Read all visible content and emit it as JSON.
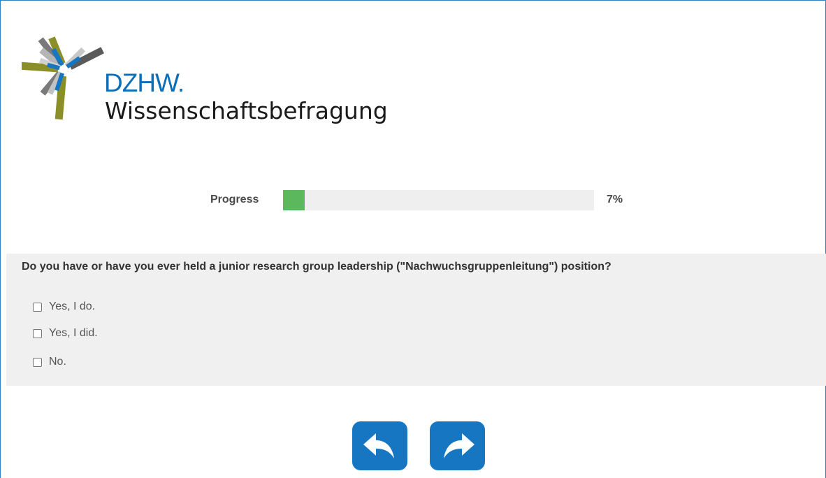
{
  "logo": {
    "abbrev": "DZHW.",
    "name": "Wissenschaftsbefragung"
  },
  "progress": {
    "label": "Progress",
    "percent": 7,
    "value_text": "7%",
    "fill_color": "#5cb85c"
  },
  "question": {
    "text": "Do you have or have you ever held a junior research group leadership (\"Nachwuchsgruppenleitung\") position?",
    "options": [
      {
        "label": "Yes, I do.",
        "checked": false
      },
      {
        "label": "Yes, I did.",
        "checked": false
      },
      {
        "label": "No.",
        "checked": false
      }
    ]
  },
  "navigation": {
    "back_icon": "arrow-back-icon",
    "next_icon": "arrow-forward-icon",
    "button_color": "#1776c2"
  }
}
